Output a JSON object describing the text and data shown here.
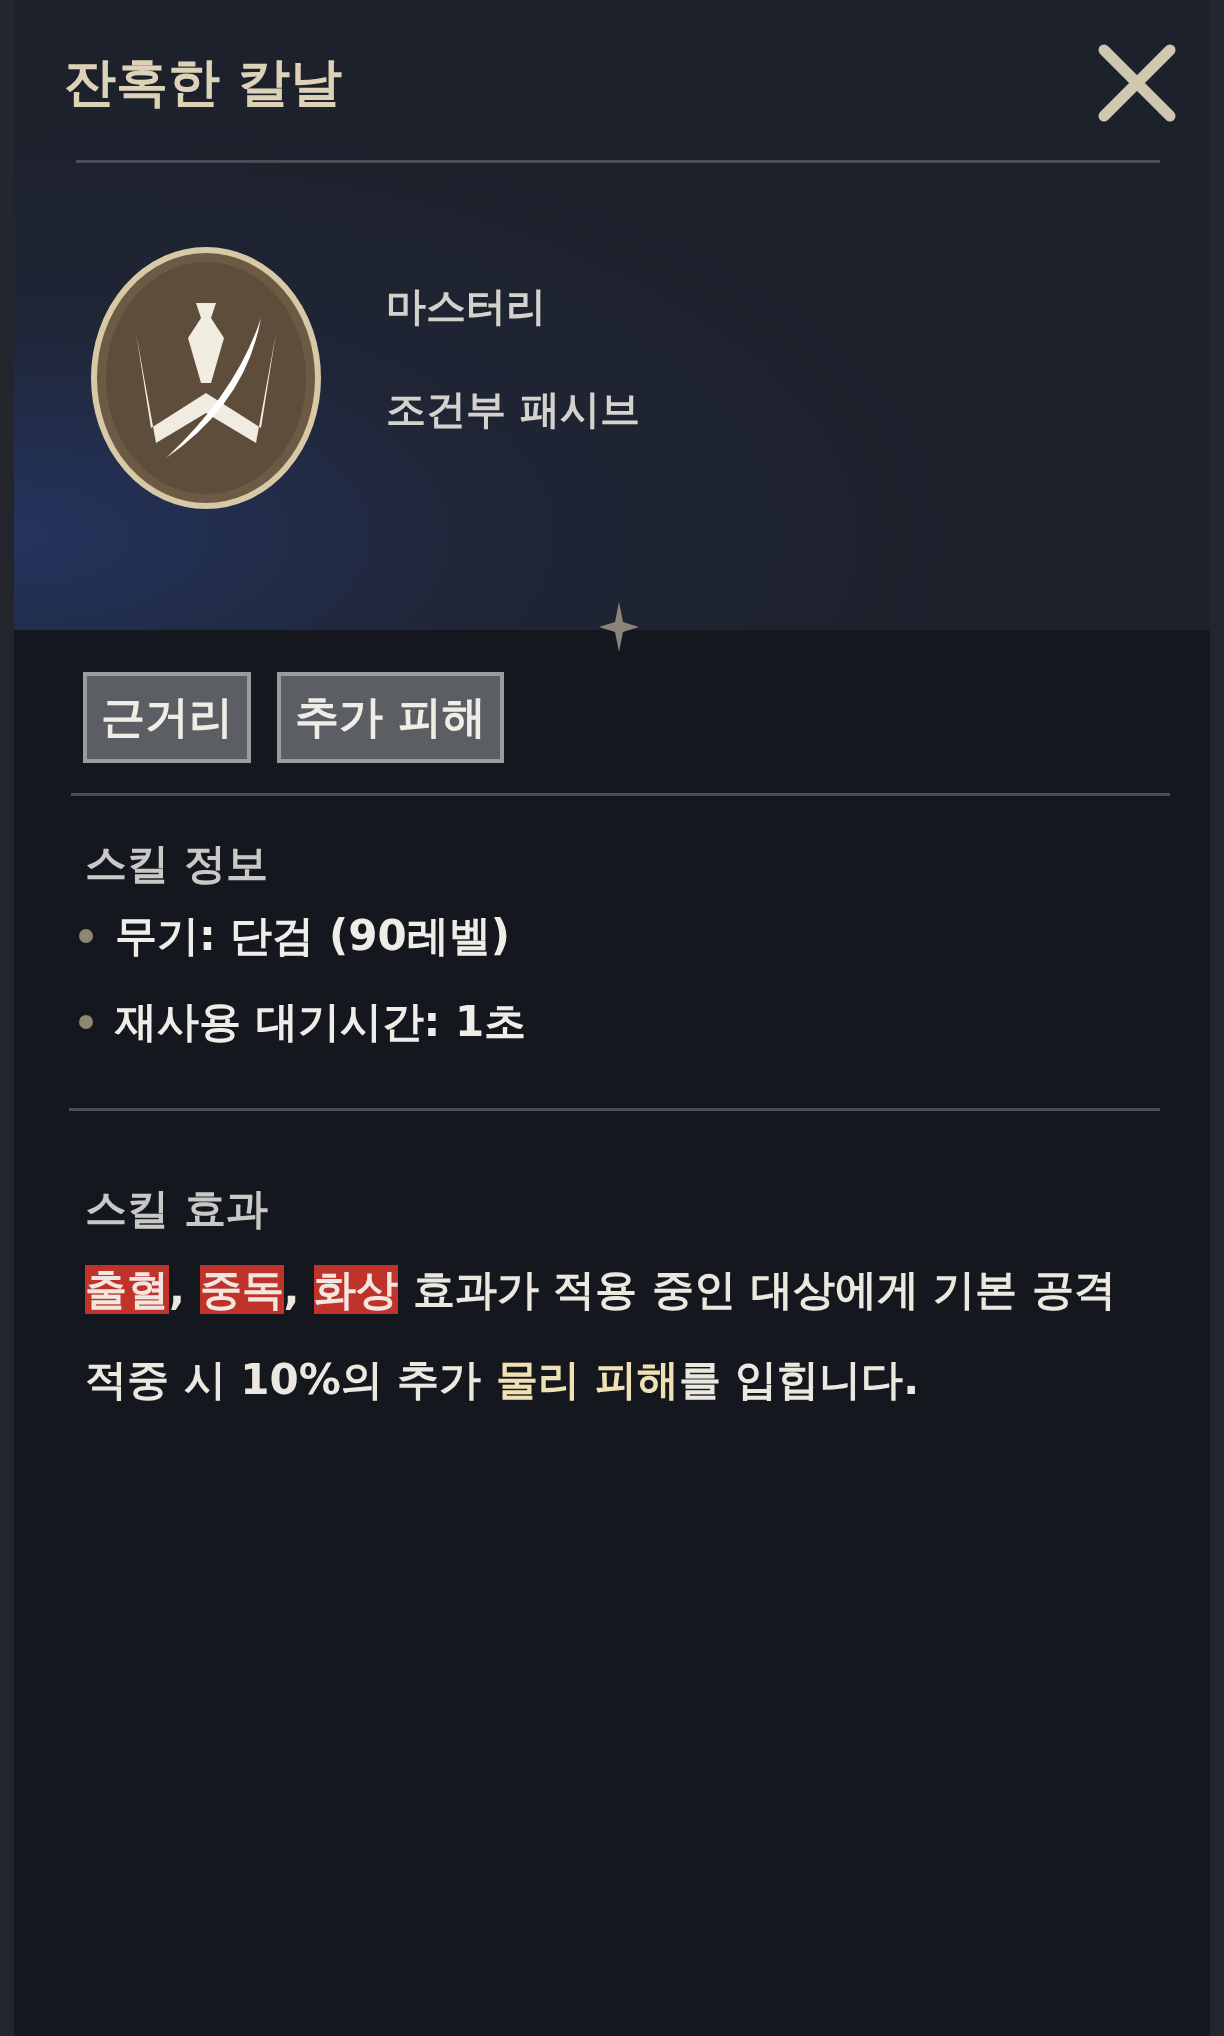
{
  "title": "잔혹한 칼날",
  "skill": {
    "type": "마스터리",
    "subtype": "조건부 패시브"
  },
  "tags": [
    "근거리",
    "추가 피해"
  ],
  "info": {
    "heading": "스킬 정보",
    "items": [
      "무기: 단검 (90레벨)",
      "재사용 대기시간: 1초"
    ]
  },
  "effect": {
    "heading": "스킬 효과",
    "segments": [
      {
        "kind": "status",
        "text": "출혈"
      },
      {
        "kind": "plain",
        "text": ", "
      },
      {
        "kind": "status",
        "text": "중독"
      },
      {
        "kind": "plain",
        "text": ", "
      },
      {
        "kind": "status",
        "text": "화상"
      },
      {
        "kind": "plain",
        "text": " 효과가 적용 중인 대상에게 기본 공격 적중 시 10%의 추가 "
      },
      {
        "kind": "damage",
        "text": "물리 피해"
      },
      {
        "kind": "plain",
        "text": "를 입힙니다."
      }
    ]
  }
}
